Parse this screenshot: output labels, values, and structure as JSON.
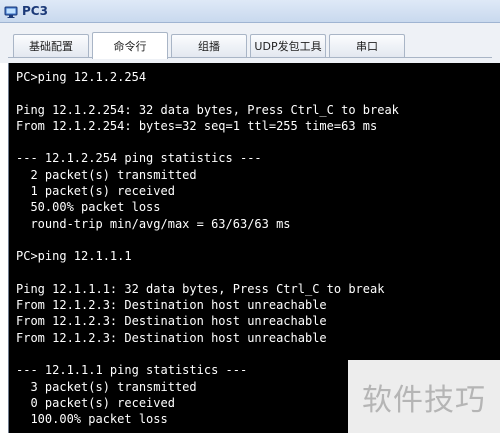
{
  "window": {
    "title": "PC3",
    "icon": "pc-monitor-icon"
  },
  "tabs": [
    {
      "label": "基础配置",
      "active": false
    },
    {
      "label": "命令行",
      "active": true
    },
    {
      "label": "组播",
      "active": false
    },
    {
      "label": "UDP发包工具",
      "active": false
    },
    {
      "label": "串口",
      "active": false
    }
  ],
  "console": {
    "lines": [
      "PC>ping 12.1.2.254",
      "",
      "Ping 12.1.2.254: 32 data bytes, Press Ctrl_C to break",
      "From 12.1.2.254: bytes=32 seq=1 ttl=255 time=63 ms",
      "",
      "--- 12.1.2.254 ping statistics ---",
      "  2 packet(s) transmitted",
      "  1 packet(s) received",
      "  50.00% packet loss",
      "  round-trip min/avg/max = 63/63/63 ms",
      "",
      "PC>ping 12.1.1.1",
      "",
      "Ping 12.1.1.1: 32 data bytes, Press Ctrl_C to break",
      "From 12.1.2.3: Destination host unreachable",
      "From 12.1.2.3: Destination host unreachable",
      "From 12.1.2.3: Destination host unreachable",
      "",
      "--- 12.1.1.1 ping statistics ---",
      "  3 packet(s) transmitted",
      "  0 packet(s) received",
      "  100.00% packet loss"
    ]
  },
  "watermark": "软件技巧",
  "colors": {
    "terminal_bg": "#000000",
    "terminal_fg": "#ffffff",
    "title_text": "#1c3a78"
  }
}
